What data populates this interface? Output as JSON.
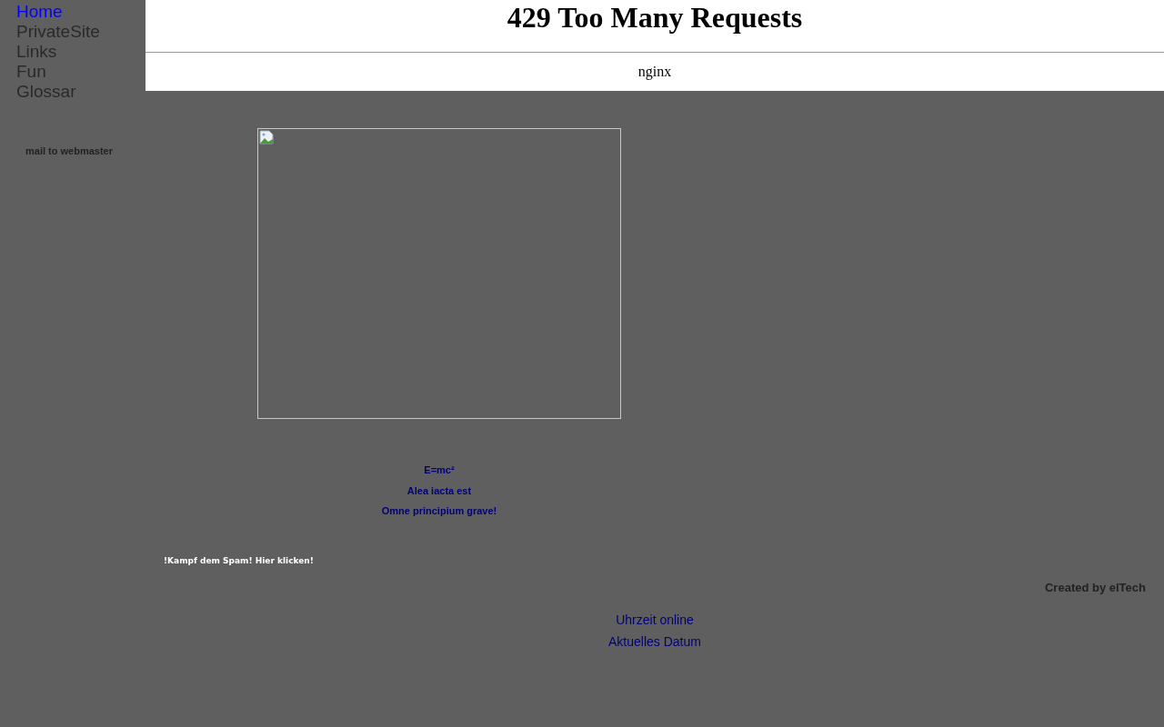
{
  "nav": [
    {
      "label": "Home",
      "selected": true
    },
    {
      "label": "PrivateSite",
      "selected": false
    },
    {
      "label": "Links",
      "selected": false
    },
    {
      "label": "Fun",
      "selected": false
    },
    {
      "label": "Glossar",
      "selected": false
    }
  ],
  "mail_link": "mail to webmaster",
  "error": {
    "title": "429 Too Many Requests",
    "server": "nginx"
  },
  "quotes": [
    "E=mc²",
    "Alea iacta est",
    "Omne principium grave!"
  ],
  "spam_link": "!Kampf dem Spam! Hier klicken!",
  "credit": "Created by elTech",
  "footer_links": [
    "Uhrzeit online",
    "Aktuelles Datum"
  ]
}
